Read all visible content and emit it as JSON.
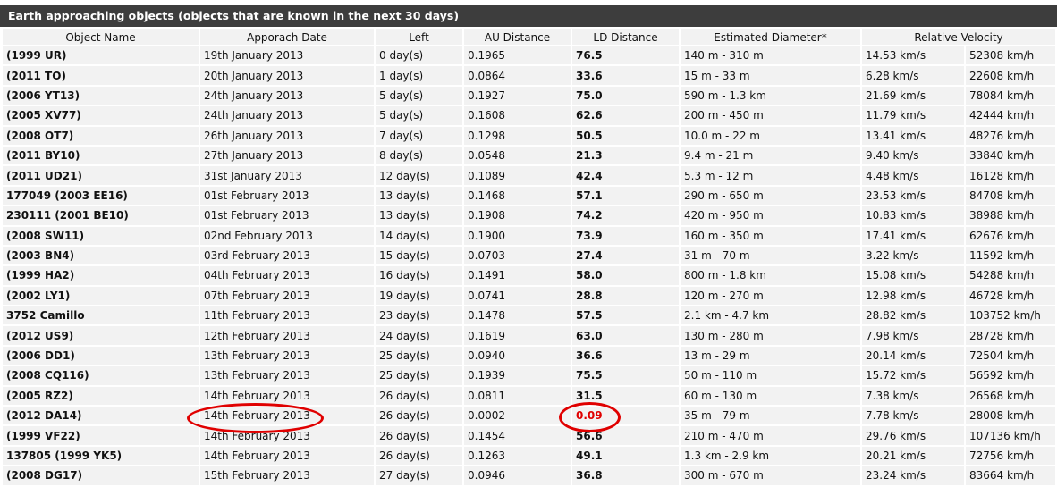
{
  "title": "Earth approaching objects (objects that are known in the next 30 days)",
  "columns": [
    "Object Name",
    "Apporach Date",
    "Left",
    "AU Distance",
    "LD Distance",
    "Estimated Diameter*",
    "Relative Velocity"
  ],
  "rows": [
    [
      "(1999 UR)",
      "19th January 2013",
      "0 day(s)",
      "0.1965",
      "76.5",
      "140 m - 310 m",
      "14.53 km/s",
      "52308 km/h"
    ],
    [
      "(2011 TO)",
      "20th January 2013",
      "1 day(s)",
      "0.0864",
      "33.6",
      "15 m - 33 m",
      "6.28 km/s",
      "22608 km/h"
    ],
    [
      "(2006 YT13)",
      "24th January 2013",
      "5 day(s)",
      "0.1927",
      "75.0",
      "590 m - 1.3 km",
      "21.69 km/s",
      "78084 km/h"
    ],
    [
      "(2005 XV77)",
      "24th January 2013",
      "5 day(s)",
      "0.1608",
      "62.6",
      "200 m - 450 m",
      "11.79 km/s",
      "42444 km/h"
    ],
    [
      "(2008 OT7)",
      "26th January 2013",
      "7 day(s)",
      "0.1298",
      "50.5",
      "10.0 m - 22 m",
      "13.41 km/s",
      "48276 km/h"
    ],
    [
      "(2011 BY10)",
      "27th January 2013",
      "8 day(s)",
      "0.0548",
      "21.3",
      "9.4 m - 21 m",
      "9.40 km/s",
      "33840 km/h"
    ],
    [
      "(2011 UD21)",
      "31st January 2013",
      "12 day(s)",
      "0.1089",
      "42.4",
      "5.3 m - 12 m",
      "4.48 km/s",
      "16128 km/h"
    ],
    [
      "177049 (2003 EE16)",
      "01st February 2013",
      "13 day(s)",
      "0.1468",
      "57.1",
      "290 m - 650 m",
      "23.53 km/s",
      "84708 km/h"
    ],
    [
      "230111 (2001 BE10)",
      "01st February 2013",
      "13 day(s)",
      "0.1908",
      "74.2",
      "420 m - 950 m",
      "10.83 km/s",
      "38988 km/h"
    ],
    [
      "(2008 SW11)",
      "02nd February 2013",
      "14 day(s)",
      "0.1900",
      "73.9",
      "160 m - 350 m",
      "17.41 km/s",
      "62676 km/h"
    ],
    [
      "(2003 BN4)",
      "03rd February 2013",
      "15 day(s)",
      "0.0703",
      "27.4",
      "31 m - 70 m",
      "3.22 km/s",
      "11592 km/h"
    ],
    [
      "(1999 HA2)",
      "04th February 2013",
      "16 day(s)",
      "0.1491",
      "58.0",
      "800 m - 1.8 km",
      "15.08 km/s",
      "54288 km/h"
    ],
    [
      "(2002 LY1)",
      "07th February 2013",
      "19 day(s)",
      "0.0741",
      "28.8",
      "120 m - 270 m",
      "12.98 km/s",
      "46728 km/h"
    ],
    [
      "3752 Camillo",
      "11th February 2013",
      "23 day(s)",
      "0.1478",
      "57.5",
      "2.1 km - 4.7 km",
      "28.82 km/s",
      "103752 km/h"
    ],
    [
      "(2012 US9)",
      "12th February 2013",
      "24 day(s)",
      "0.1619",
      "63.0",
      "130 m - 280 m",
      "7.98 km/s",
      "28728 km/h"
    ],
    [
      "(2006 DD1)",
      "13th February 2013",
      "25 day(s)",
      "0.0940",
      "36.6",
      "13 m - 29 m",
      "20.14 km/s",
      "72504 km/h"
    ],
    [
      "(2008 CQ116)",
      "13th February 2013",
      "25 day(s)",
      "0.1939",
      "75.5",
      "50 m - 110 m",
      "15.72 km/s",
      "56592 km/h"
    ],
    [
      "(2005 RZ2)",
      "14th February 2013",
      "26 day(s)",
      "0.0811",
      "31.5",
      "60 m - 130 m",
      "7.38 km/s",
      "26568 km/h"
    ],
    [
      "(2012 DA14)",
      "14th February 2013",
      "26 day(s)",
      "0.0002",
      "0.09",
      "35 m - 79 m",
      "7.78 km/s",
      "28008 km/h"
    ],
    [
      "(1999 VF22)",
      "14th February 2013",
      "26 day(s)",
      "0.1454",
      "56.6",
      "210 m - 470 m",
      "29.76 km/s",
      "107136 km/h"
    ],
    [
      "137805 (1999 YK5)",
      "14th February 2013",
      "26 day(s)",
      "0.1263",
      "49.1",
      "1.3 km - 2.9 km",
      "20.21 km/s",
      "72756 km/h"
    ],
    [
      "(2008 DG17)",
      "15th February 2013",
      "27 day(s)",
      "0.0946",
      "36.8",
      "300 m - 670 m",
      "23.24 km/s",
      "83664 km/h"
    ]
  ],
  "highlight_row": 18,
  "colors": {
    "header_bg": "#3d3d3d",
    "cell_bg": "#f2f2f2",
    "highlight": "#e00000"
  }
}
